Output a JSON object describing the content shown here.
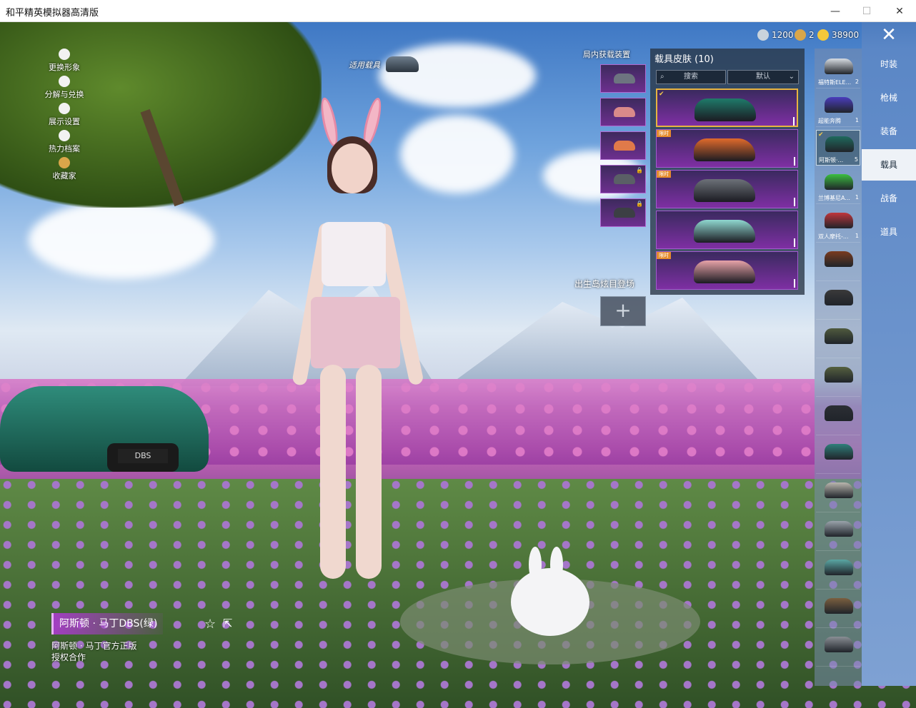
{
  "window": {
    "title": "和平精英模拟器高清版",
    "controls": [
      "—",
      "☐",
      "✕"
    ]
  },
  "left_menu": [
    {
      "label": "更换形象",
      "icon": "person-icon"
    },
    {
      "label": "分解与兑换",
      "icon": "puzzle-icon"
    },
    {
      "label": "展示设置",
      "icon": "eye-icon"
    },
    {
      "label": "热力档案",
      "icon": "flame-icon"
    },
    {
      "label": "收藏家",
      "icon": "crown-icon"
    }
  ],
  "apply_vehicle_label": "适用载具",
  "currency": [
    {
      "value": "1200",
      "icon": "coin-silver-icon",
      "color": "#c9d3dc"
    },
    {
      "value": "2",
      "icon": "token-icon",
      "color": "#d9a64a"
    },
    {
      "value": "38900",
      "icon": "coin-gold-icon",
      "color": "#f3c83a"
    }
  ],
  "thumb_column_title": "局内获载装置",
  "thumbs": [
    {
      "color": "#6d7480",
      "locked": false
    },
    {
      "color": "#d98a8a",
      "locked": false
    },
    {
      "color": "#e07a4a",
      "locked": false
    },
    {
      "color": "#5a5f66",
      "locked": true
    },
    {
      "color": "#3c3f44",
      "locked": true
    }
  ],
  "lock_glyph": "🔒",
  "birth_label": "出生岛炫目登场",
  "add_button": "+",
  "skin_panel": {
    "title": "载具皮肤 (10)",
    "search": "搜索",
    "sort": "默认",
    "cards": [
      {
        "color": "#1f7a6a",
        "badge": "",
        "selected": true
      },
      {
        "color": "#e06a2c",
        "badge": "限时",
        "selected": false
      },
      {
        "color": "#6c7178",
        "badge": "限时",
        "selected": false
      },
      {
        "color": "#8fd8d0",
        "badge": "",
        "selected": false
      },
      {
        "color": "#e7a3a8",
        "badge": "限时",
        "selected": false
      }
    ]
  },
  "vehicles": [
    {
      "name": "福特斯ELE...",
      "count": "2",
      "color": "#d8dde3",
      "selected": false
    },
    {
      "name": "超能奔腾",
      "count": "1",
      "color": "#4a3dbd",
      "selected": false
    },
    {
      "name": "阿斯顿·...",
      "count": "5",
      "color": "#1f6a5d",
      "selected": true
    },
    {
      "name": "兰博基尼A...",
      "count": "1",
      "color": "#3bbf3f",
      "selected": false
    },
    {
      "name": "双人摩托-...",
      "count": "1",
      "color": "#c0363b",
      "selected": false
    },
    {
      "name": "",
      "count": "",
      "color": "#7a3b1f",
      "selected": false
    },
    {
      "name": "",
      "count": "",
      "color": "#3a3a3a",
      "selected": false
    },
    {
      "name": "",
      "count": "",
      "color": "#4f5a3e",
      "selected": false
    },
    {
      "name": "",
      "count": "",
      "color": "#55603f",
      "selected": false
    },
    {
      "name": "",
      "count": "",
      "color": "#2c2f35",
      "selected": false
    },
    {
      "name": "",
      "count": "",
      "color": "#2f7f7a",
      "selected": false
    },
    {
      "name": "",
      "count": "",
      "color": "#b9b6ae",
      "selected": false
    },
    {
      "name": "",
      "count": "",
      "color": "#9aa3ab",
      "selected": false
    },
    {
      "name": "",
      "count": "",
      "color": "#5aa7a4",
      "selected": false
    },
    {
      "name": "",
      "count": "",
      "color": "#7b5f3f",
      "selected": false
    },
    {
      "name": "",
      "count": "",
      "color": "#8a8f95",
      "selected": false
    }
  ],
  "categories": [
    {
      "label": "时装",
      "active": false
    },
    {
      "label": "枪械",
      "active": false
    },
    {
      "label": "装备",
      "active": false
    },
    {
      "label": "载具",
      "active": true
    },
    {
      "label": "战备",
      "active": false
    },
    {
      "label": "道具",
      "active": false
    }
  ],
  "close_glyph": "✕",
  "info": {
    "name": "阿斯顿 · 马丁DBS(绿)",
    "sub_line1": "阿斯顿 · 马丁官方正版",
    "sub_line2": "授权合作",
    "fav_glyph": "☆",
    "share_glyph": "⇱"
  },
  "car_plate": "DBS"
}
